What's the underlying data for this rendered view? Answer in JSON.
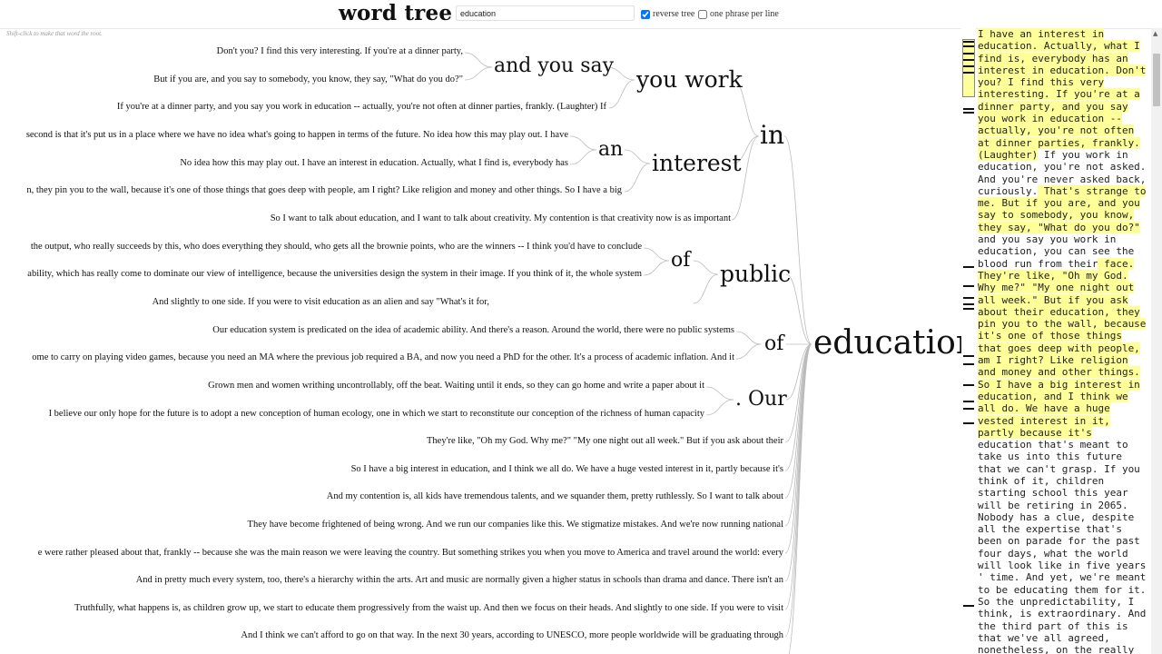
{
  "header": {
    "title": "word tree",
    "search_value": "education",
    "reverse_tree_label": "reverse tree",
    "reverse_tree_checked": true,
    "one_phrase_label": "one phrase per line",
    "one_phrase_checked": false
  },
  "hint": "Shift-click to make that word the root.",
  "tree": {
    "root": "education",
    "contexts": [
      "Don't you? I find this very interesting. If you're at a dinner party,",
      "But if you are, and you say to somebody, you know, they say, \"What do you do?\"",
      "If you're at a dinner party, and you say you work in education -- actually, you're not often at dinner parties, frankly. (Laughter) If",
      "second is that it's put us in a place where we have no idea what's going to happen in terms of the future. No idea how this may play out. I have",
      "No idea how this may play out. I have an interest in education. Actually, what I find is, everybody has",
      "n, they pin you to the wall, because it's one of those things that goes deep with people, am I right? Like religion and money and other things. So I have a big",
      "So I want to talk about education, and I want to talk about creativity. My contention is that creativity now is as important",
      "the output, who really succeeds by this, who does everything they should, who gets all the brownie points, who are the winners -- I think you'd have to conclude",
      "ability, which has really come to dominate our view of intelligence, because the universities design the system in their image. If you think of it, the whole system",
      "And slightly to one side. If you were to visit education as an alien and say \"What's it for,",
      "Our education system is predicated on the idea of academic ability. And there's a reason. Around the world, there were no public systems",
      "ome to carry on playing video games, because you need an MA where the previous job required a BA, and now you need a PhD for the other. It's a process of academic inflation. And it",
      "Grown men and women writhing uncontrollably, off the beat. Waiting until it ends, so they can go home and write a paper about it",
      "I believe our only hope for the future is to adopt a new conception of human ecology, one in which we start to reconstitute our conception of the richness of human capacity",
      "They're like, \"Oh my God. Why me?\" \"My one night out all week.\" But if you ask about their",
      "So I have a big interest in education, and I think we all do. We have a huge vested interest in it, partly because it's",
      "And my contention is, all kids have tremendous talents, and we squander them, pretty ruthlessly. So I want to talk about",
      "They have become frightened of being wrong. And we run our companies like this. We stigmatize mistakes. And we're now running national",
      "e were rather pleased about that, frankly -- because she was the main reason we were leaving the country. But something strikes you when you move to America and travel around the world: every",
      "And in pretty much every system, too, there's a hierarchy within the arts. Art and music are normally given a higher status in schools than drama and dance. There isn't an",
      "Truthfully, what happens is, as children grow up, we start to educate them progressively from the waist up. And then we focus on their heads. And slightly to one side. If you were to visit",
      "And I think we can't afford to go on that way. In the next 30 years, according to UNESCO, more people worldwide will be graduating through"
    ],
    "words": {
      "and_you_say": "and you say",
      "you_work": "you work",
      "in": "in",
      "an": "an",
      "interest": "interest",
      "of_1": "of",
      "public": "public",
      "of_2": "of",
      "our": ". Our"
    }
  },
  "text_pane": {
    "highlight_1": "I have an interest in education. Actually, what I find is, everybody has an interest in education. Don't you? I find this very interesting. If you're at a dinner party, and you say you work in education -- actually, you're not often at dinner parties, frankly. (Laughter)",
    "plain_1": " If you work in education, you're not asked. And you're never asked back, curiously.",
    "highlight_2": " That's strange to me. But if you are, and you say to somebody, you know, they say, \"What do you do?\"",
    "plain_2": " and you say you work in education, you can see the blood run from their",
    "highlight_3": " face. They're like, \"Oh my God. Why me?\" \"My one night out all week.\" But if you ask about their education, they pin you to the wall, because it's one of those things that goes deep with people, am I right? Like religion and money and other things. So I have a big interest in education, and I think we all do. We have a huge vested interest in it, partly because it's",
    "plain_3": " education that's meant to take us into this future that we can't grasp. If you think of it, children starting school this year will be retiring in 2065. Nobody has a clue, despite all the expertise that's been on parade for the past four days, what the world will look like in five years ' time. And yet, we're meant to be educating them for it. So the unpredictability, I think, is extraordinary. And the third part of this is that we've all agreed, nonetheless, on the really"
  }
}
